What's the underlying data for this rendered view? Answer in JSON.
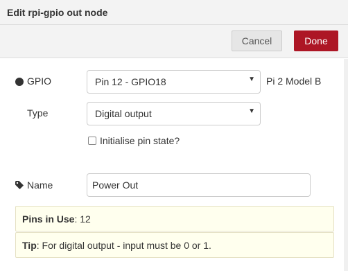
{
  "dialog": {
    "title": "Edit rpi-gpio out node"
  },
  "toolbar": {
    "cancel_label": "Cancel",
    "done_label": "Done"
  },
  "form": {
    "gpio_label": "GPIO",
    "gpio_value": "Pin 12 - GPIO18",
    "board_model": "Pi 2 Model B",
    "type_label": "Type",
    "type_value": "Digital output",
    "init_label": "Initialise pin state?",
    "init_checked": false,
    "name_label": "Name",
    "name_value": "Power Out"
  },
  "info": {
    "pins_label": "Pins in Use",
    "pins_value": ": 12",
    "tip_label": "Tip",
    "tip_text": ": For digital output - input must be 0 or 1."
  },
  "colors": {
    "done_button": "#ad1625",
    "info_background": "#ffffee"
  },
  "icons": {
    "gpio": "circle-icon",
    "select": "caret-down-icon",
    "name": "tag-icon"
  }
}
